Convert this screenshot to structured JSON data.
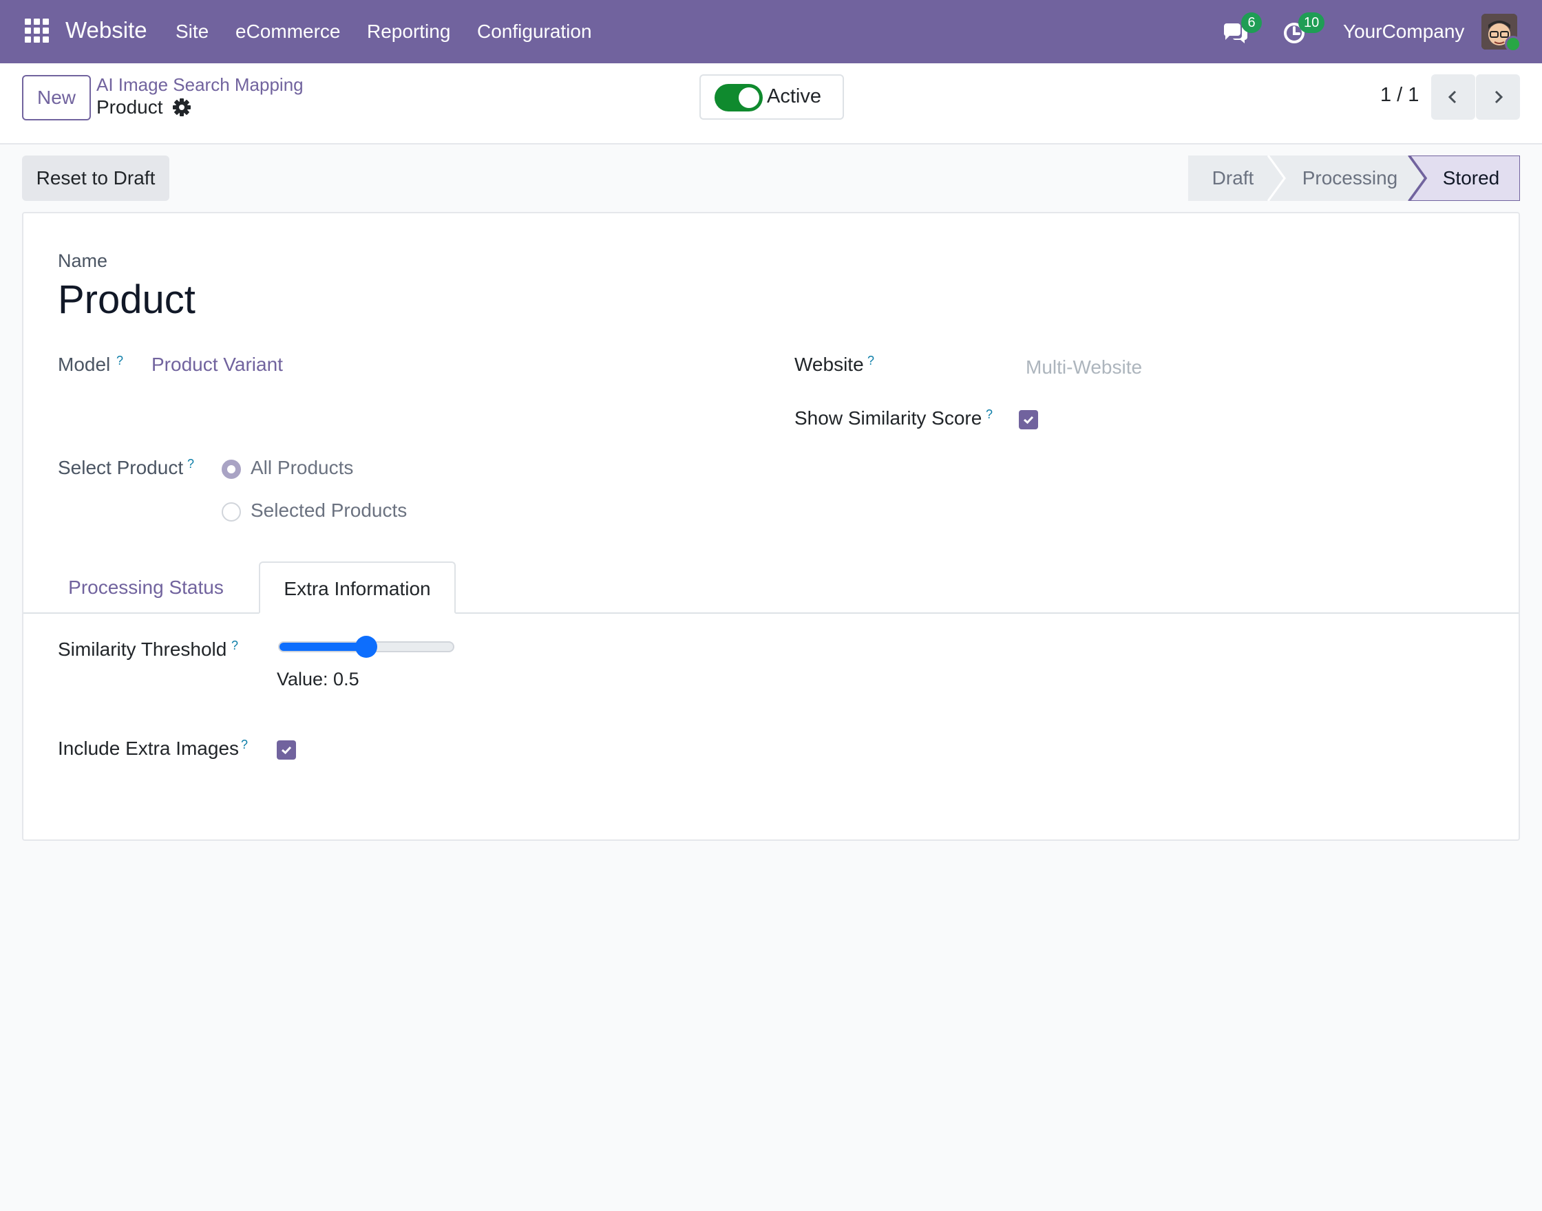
{
  "navbar": {
    "app_name": "Website",
    "menu": [
      "Site",
      "eCommerce",
      "Reporting",
      "Configuration"
    ],
    "messages_count": "6",
    "activities_count": "10",
    "company": "YourCompany"
  },
  "control_panel": {
    "new_label": "New",
    "breadcrumb_parent": "AI Image Search Mapping",
    "breadcrumb_current": "Product",
    "active_label": "Active",
    "active_on": true,
    "pager": "1 / 1"
  },
  "statusbar": {
    "reset_label": "Reset to Draft",
    "stages": [
      "Draft",
      "Processing",
      "Stored"
    ],
    "current_stage": "Stored"
  },
  "form": {
    "name_label": "Name",
    "name_value": "Product",
    "model_label": "Model",
    "model_value": "Product Variant",
    "website_label": "Website",
    "website_placeholder": "Multi-Website",
    "show_similarity_label": "Show Similarity Score",
    "show_similarity_checked": true,
    "select_product_label": "Select Product",
    "select_product_options": [
      "All Products",
      "Selected Products"
    ],
    "select_product_value": "All Products",
    "help_mark": "?"
  },
  "tabs": {
    "items": [
      "Processing Status",
      "Extra Information"
    ],
    "active": "Extra Information"
  },
  "extra_info": {
    "threshold_label": "Similarity Threshold",
    "threshold_value": 0.5,
    "threshold_text": "Value: 0.5",
    "include_extra_label": "Include Extra Images",
    "include_extra_checked": true
  },
  "colors": {
    "brand": "#71639e",
    "badge": "#1f9d55",
    "toggle_on": "#0f8a2e",
    "slider": "#0d6efd"
  },
  "icons": [
    "apps-grid-icon",
    "chat-icon",
    "clock-icon",
    "gear-icon",
    "chevron-left-icon",
    "chevron-right-icon",
    "check-icon"
  ]
}
